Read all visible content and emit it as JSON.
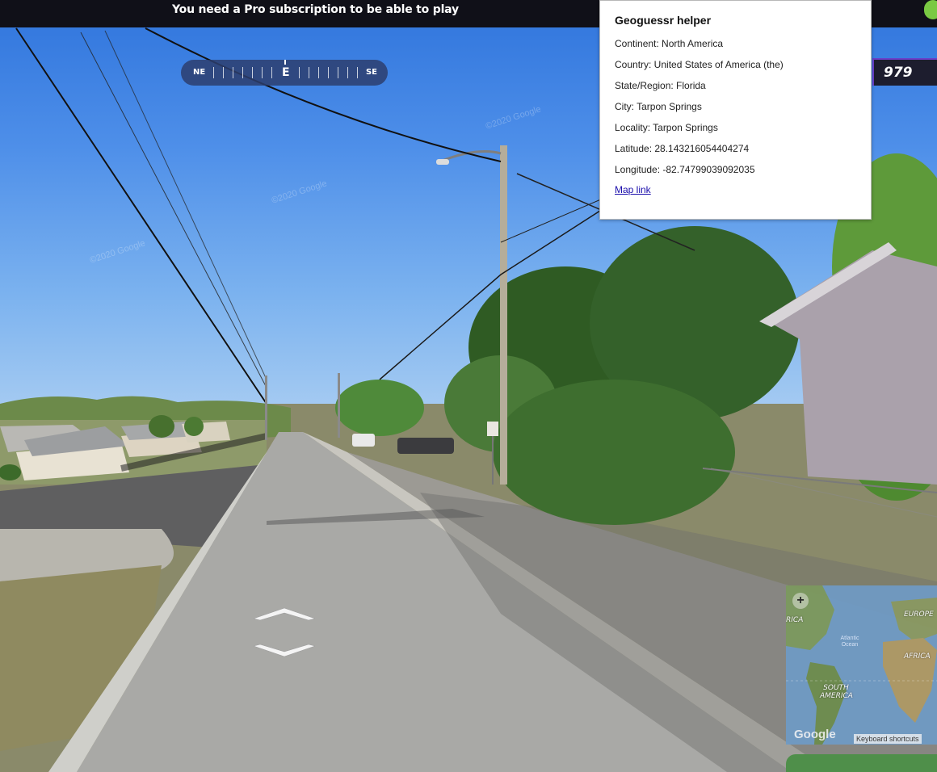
{
  "banner": {
    "message": "You need a Pro subscription to be able to play"
  },
  "compass": {
    "left": "NE",
    "center": "E",
    "right": "SE"
  },
  "score": {
    "value": "979"
  },
  "helper": {
    "title": "Geoguessr helper",
    "continent": "Continent: North America",
    "country": "Country: United States of America (the)",
    "state": "State/Region: Florida",
    "city": "City: Tarpon Springs",
    "locality": "Locality: Tarpon Springs",
    "latitude": "Latitude: 28.143216054404274",
    "longitude": "Longitude: -82.74799039092035",
    "map_link": "Map link"
  },
  "minimap": {
    "labels": {
      "north_america": "RICA",
      "europe": "EUROPE",
      "africa": "AFRICA",
      "south_america": "SOUTH AMERICA",
      "atlantic": "Atlantic Ocean"
    },
    "google": "Google",
    "keyboard_shortcuts": "Keyboard shortcuts"
  },
  "watermarks": [
    "©2020 Google",
    "©2020 Google",
    "©2020 Google"
  ]
}
